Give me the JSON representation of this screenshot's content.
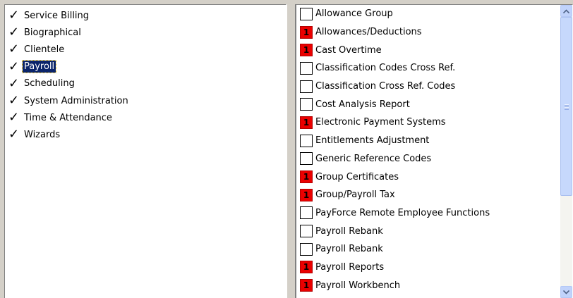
{
  "modules": [
    {
      "label": "Service Billing",
      "selected": false
    },
    {
      "label": "Biographical",
      "selected": false
    },
    {
      "label": "Clientele",
      "selected": false
    },
    {
      "label": "Payroll",
      "selected": true
    },
    {
      "label": "Scheduling",
      "selected": false
    },
    {
      "label": "System Administration",
      "selected": false
    },
    {
      "label": "Time & Attendance",
      "selected": false
    },
    {
      "label": "Wizards",
      "selected": false
    }
  ],
  "functions": [
    {
      "label": "Allowance Group",
      "level": ""
    },
    {
      "label": "Allowances/Deductions",
      "level": "1"
    },
    {
      "label": "Cast Overtime",
      "level": "1"
    },
    {
      "label": "Classification Codes Cross Ref.",
      "level": ""
    },
    {
      "label": "Classification Cross Ref. Codes",
      "level": ""
    },
    {
      "label": "Cost Analysis Report",
      "level": ""
    },
    {
      "label": "Electronic Payment Systems",
      "level": "1"
    },
    {
      "label": "Entitlements Adjustment",
      "level": ""
    },
    {
      "label": "Generic Reference Codes",
      "level": ""
    },
    {
      "label": "Group Certificates",
      "level": "1"
    },
    {
      "label": "Group/Payroll Tax",
      "level": "1"
    },
    {
      "label": "PayForce Remote Employee Functions",
      "level": ""
    },
    {
      "label": "Payroll Rebank",
      "level": ""
    },
    {
      "label": "Payroll Rebank",
      "level": ""
    },
    {
      "label": "Payroll Reports",
      "level": "1"
    },
    {
      "label": "Payroll Workbench",
      "level": "1"
    }
  ],
  "colors": {
    "selection": "#0a246a",
    "level_badge": "#ea0000",
    "scrollbar": "#c1d3fb"
  },
  "icons": {
    "check": "check-icon",
    "scroll_up": "arrow-up-icon",
    "scroll_down": "arrow-down-icon"
  }
}
